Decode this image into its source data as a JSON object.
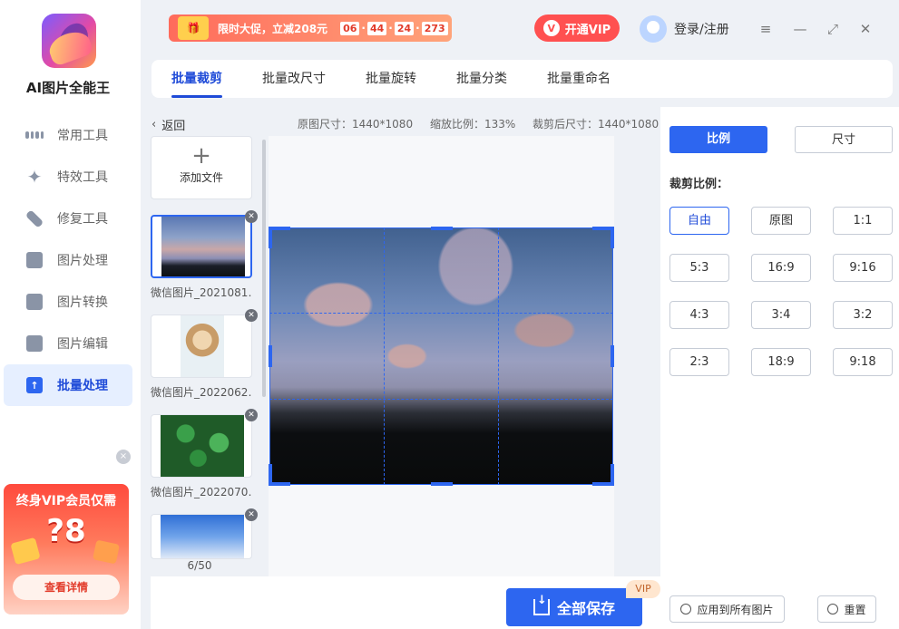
{
  "app": {
    "name": "AI图片全能王"
  },
  "sidebar": {
    "items": [
      {
        "label": "常用工具",
        "icon": "grid-icon"
      },
      {
        "label": "特效工具",
        "icon": "star-icon"
      },
      {
        "label": "修复工具",
        "icon": "bandage-icon"
      },
      {
        "label": "图片处理",
        "icon": "image-icon"
      },
      {
        "label": "图片转换",
        "icon": "convert-icon"
      },
      {
        "label": "图片编辑",
        "icon": "edit-icon"
      },
      {
        "label": "批量处理",
        "icon": "upload-folder-icon",
        "active": true
      }
    ],
    "promo": {
      "title": "终身VIP会员仅需",
      "price": "?8",
      "button": "查看详情",
      "close": "×"
    }
  },
  "topbar": {
    "sale_text": "限时大促，立减208元",
    "timer": [
      "06",
      "44",
      "24",
      "273"
    ],
    "vip_label": "开通VIP",
    "login_label": "登录/注册"
  },
  "tabs": [
    {
      "label": "批量裁剪",
      "active": true
    },
    {
      "label": "批量改尺寸"
    },
    {
      "label": "批量旋转"
    },
    {
      "label": "批量分类"
    },
    {
      "label": "批量重命名"
    }
  ],
  "editor": {
    "back_label": "返回",
    "original_size": "原图尺寸：1440*1080",
    "zoom": "缩放比例：133%",
    "cropped_size": "裁剪后尺寸：1440*1080",
    "add_file": "添加文件",
    "files": [
      {
        "name": "微信图片_2021081…",
        "selected": true
      },
      {
        "name": "微信图片_2022062…"
      },
      {
        "name": "微信图片_2022070…"
      },
      {
        "name": ""
      }
    ],
    "counter": "6/50",
    "save_label": "全部保存",
    "vip_tag": "VIP"
  },
  "panel": {
    "mode_ratio": "比例",
    "mode_size": "尺寸",
    "ratio_label": "裁剪比例：",
    "ratios": [
      "自由",
      "原图",
      "1:1",
      "5:3",
      "16:9",
      "9:16",
      "4:3",
      "3:4",
      "3:2",
      "2:3",
      "18:9",
      "9:18"
    ],
    "apply_all": "应用到所有图片",
    "reset": "重置"
  },
  "colors": {
    "accent": "#2d66f0",
    "vip_red": "#ff5050"
  }
}
